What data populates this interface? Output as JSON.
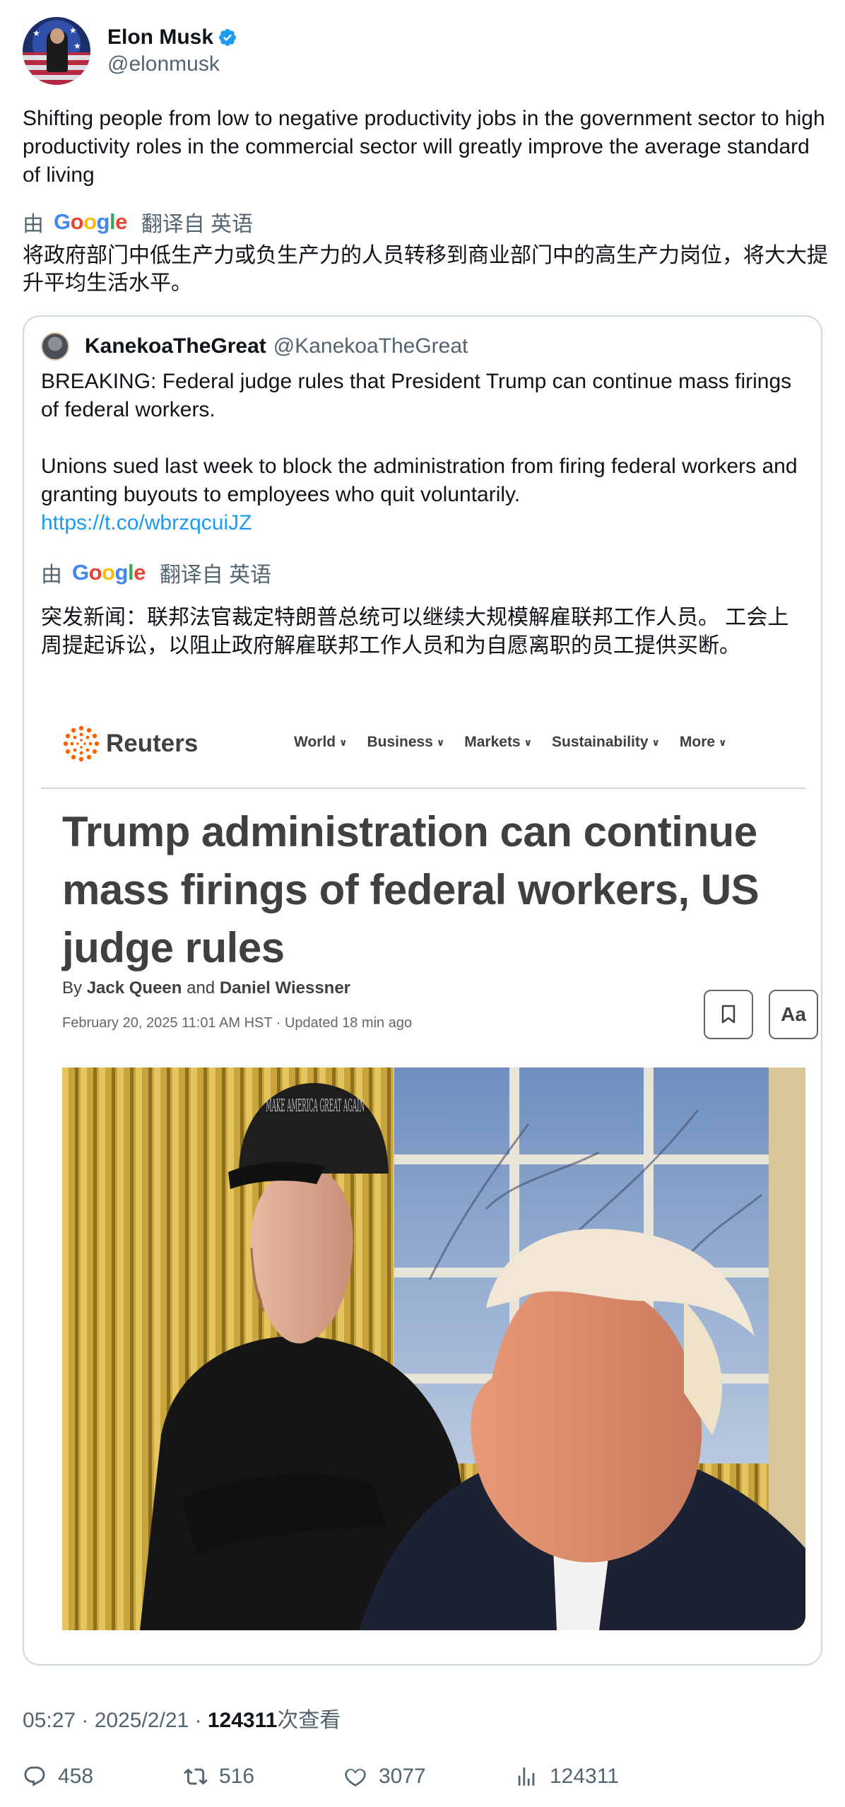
{
  "author": {
    "display_name": "Elon Musk",
    "handle": "@elonmusk",
    "verified_icon": "verified-badge-icon"
  },
  "tweet": {
    "text": "Shifting people from low to negative productivity jobs in the government sector to high productivity roles in the commercial sector will greatly improve the average standard of living",
    "translate_by": "由",
    "translate_logo": "Google",
    "translate_from": "翻译自 英语",
    "translated_text": "将政府部门中低生产力或负生产力的人员转移到商业部门中的高生产力岗位，将大大提升平均生活水平。"
  },
  "quote": {
    "display_name": "KanekoaTheGreat",
    "handle": "@KanekoaTheGreat",
    "paragraph1": "BREAKING: Federal judge rules that President Trump can continue mass firings of federal workers.",
    "paragraph2": "Unions sued last week to block the administration from firing federal workers and granting buyouts to employees who quit voluntarily.",
    "link": "https://t.co/wbrzqcuiJZ",
    "translate_by": "由",
    "translate_logo": "Google",
    "translate_from": "翻译自 英语",
    "translated_text": "突发新闻：联邦法官裁定特朗普总统可以继续大规模解雇联邦工作人员。 工会上周提起诉讼，以阻止政府解雇联邦工作人员和为自愿离职的员工提供买断。"
  },
  "article": {
    "brand": "Reuters",
    "nav": [
      "World",
      "Business",
      "Markets",
      "Sustainability",
      "More"
    ],
    "headline": "Trump administration can continue mass firings of federal workers, US judge rules",
    "by_prefix": "By",
    "author1": "Jack Queen",
    "and_text": "and",
    "author2": "Daniel Wiessner",
    "dateline": "February 20, 2025 11:01 AM HST · Updated 18 min ago",
    "text_size_label": "Aa",
    "hat_text": "MAKE AMERICA GREAT AGAIN"
  },
  "meta": {
    "time": "05:27 · 2025/2/21 · ",
    "views_count": "124311",
    "views_label": "次查看"
  },
  "actions": {
    "replies": "458",
    "reposts": "516",
    "likes": "3077",
    "views": "124311"
  },
  "colors": {
    "link": "#1d9bf0",
    "secondary_text": "#536471",
    "primary_text": "#0f1419",
    "border": "#cfd9de",
    "reuters_orange": "#fa6400"
  }
}
